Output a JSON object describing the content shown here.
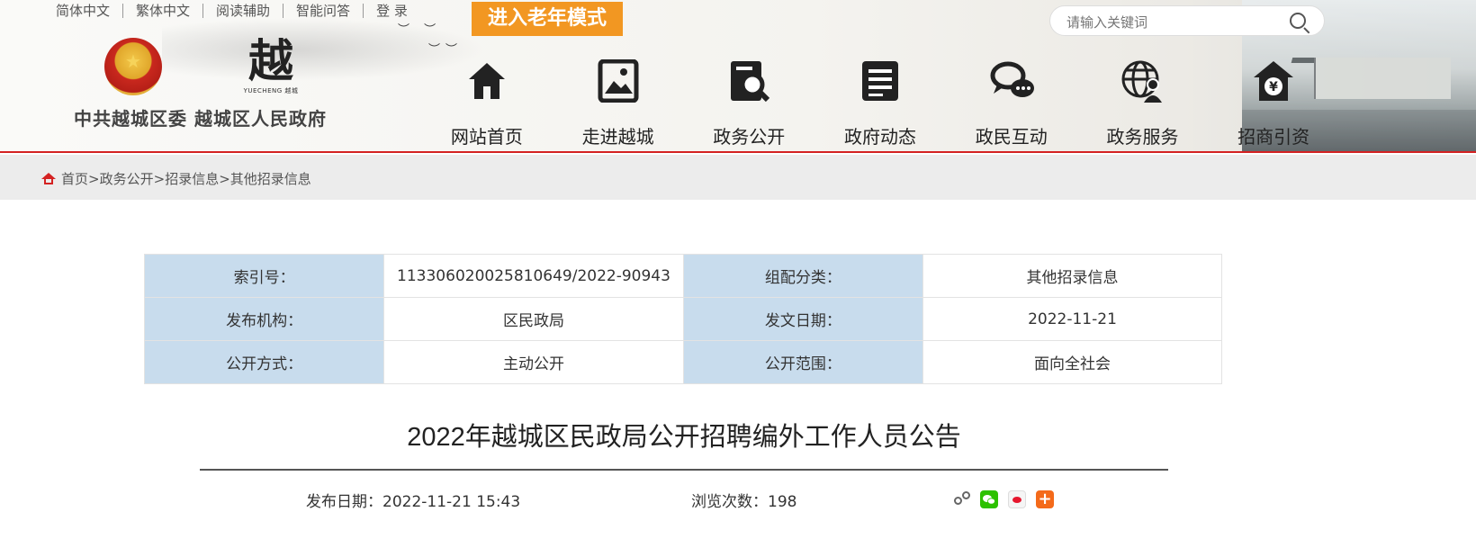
{
  "top_links": [
    "简体中文",
    "繁体中文",
    "阅读辅助",
    "智能问答",
    "登 录"
  ],
  "senior_mode_label": "进入老年模式",
  "site": {
    "name": "中共越城区委 越城区人民政府",
    "logo_glyph": "越",
    "logo_sub": "YUECHENG 越城"
  },
  "search": {
    "placeholder": "请输入关键词"
  },
  "nav": [
    {
      "label": "网站首页",
      "icon": "home-icon"
    },
    {
      "label": "走进越城",
      "icon": "picture-icon"
    },
    {
      "label": "政务公开",
      "icon": "document-search-icon"
    },
    {
      "label": "政府动态",
      "icon": "news-icon"
    },
    {
      "label": "政民互动",
      "icon": "chat-icon"
    },
    {
      "label": "政务服务",
      "icon": "globe-user-icon"
    },
    {
      "label": "招商引资",
      "icon": "yuan-house-icon"
    }
  ],
  "breadcrumb": {
    "items": [
      "首页",
      "政务公开",
      "招录信息",
      "其他招录信息"
    ],
    "separator": ">"
  },
  "meta": {
    "index_label": "索引号：",
    "index_value": "113306020025810649/2022-90943",
    "category_label": "组配分类：",
    "category_value": "其他招录信息",
    "issuer_label": "发布机构：",
    "issuer_value": "区民政局",
    "doc_date_label": "发文日期：",
    "doc_date_value": "2022-11-21",
    "open_mode_label": "公开方式：",
    "open_mode_value": "主动公开",
    "open_scope_label": "公开范围：",
    "open_scope_value": "面向全社会"
  },
  "article": {
    "title": "2022年越城区民政局公开招聘编外工作人员公告",
    "publish": "发布日期：2022-11-21 15:43",
    "views": "浏览次数：198"
  },
  "share_icons": [
    "share-icon",
    "wechat-icon",
    "weibo-icon",
    "more-icon"
  ],
  "colors": {
    "accent_red": "#d42222",
    "senior_orange": "#f29722",
    "meta_key_bg": "#c8dced",
    "crumb_bg": "#ececec"
  }
}
